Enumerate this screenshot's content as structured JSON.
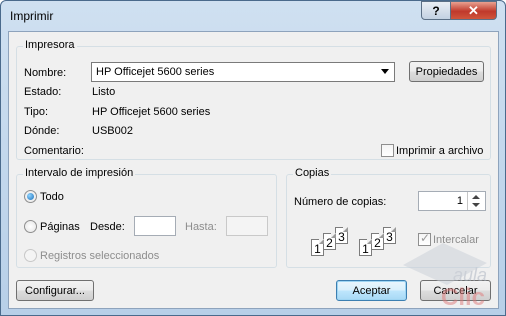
{
  "title": "Imprimir",
  "titlebar": {
    "help_glyph": "?",
    "close_glyph": "✕"
  },
  "printer": {
    "legend": "Impresora",
    "name_label": "Nombre:",
    "name_value": "HP Officejet 5600 series",
    "properties_button": "Propiedades",
    "status_label": "Estado:",
    "status_value": "Listo",
    "type_label": "Tipo:",
    "type_value": "HP Officejet 5600 series",
    "where_label": "Dónde:",
    "where_value": "USB002",
    "comment_label": "Comentario:",
    "print_to_file_label": "Imprimir a archivo"
  },
  "range": {
    "legend": "Intervalo de impresión",
    "all_label": "Todo",
    "pages_label": "Páginas",
    "from_label": "Desde:",
    "to_label": "Hasta:",
    "selection_label": "Registros seleccionados"
  },
  "copies": {
    "legend": "Copias",
    "number_label": "Número de copias:",
    "number_value": "1",
    "collate_label": "Intercalar",
    "collate_digits": [
      "1",
      "2",
      "3"
    ]
  },
  "buttons": {
    "setup": "Configurar...",
    "ok": "Aceptar",
    "cancel": "Cancelar"
  },
  "watermark": {
    "line1": "aula",
    "line2": "Clic"
  },
  "colors": {
    "title_bar_gradient_top": "#cfe0f1",
    "close_button": "#c0392b",
    "client_background": "#f0f0f0"
  }
}
